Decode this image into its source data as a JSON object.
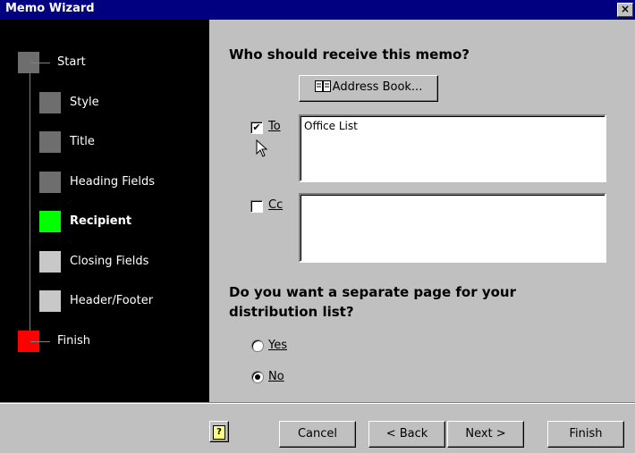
{
  "window": {
    "title": "Memo Wizard",
    "close_glyph": "×"
  },
  "steps": [
    {
      "label": "Start",
      "color": "#6e6e6e"
    },
    {
      "label": "Style",
      "color": "#6e6e6e"
    },
    {
      "label": "Title",
      "color": "#6e6e6e"
    },
    {
      "label": "Heading Fields",
      "color": "#6e6e6e"
    },
    {
      "label": "Recipient",
      "color": "#00ff00",
      "current": true
    },
    {
      "label": "Closing Fields",
      "color": "#c8c8c8"
    },
    {
      "label": "Header/Footer",
      "color": "#c8c8c8"
    },
    {
      "label": "Finish",
      "color": "#ff0000"
    }
  ],
  "main": {
    "question1": "Who should receive this memo?",
    "address_book": {
      "label": "Address Book...",
      "icon": "address-book-icon"
    },
    "to": {
      "label": "To",
      "checked": true,
      "value": "Office List"
    },
    "cc": {
      "label": "Cc",
      "checked": false,
      "value": ""
    },
    "question2_line1": "Do you want a separate page for your",
    "question2_line2": "distribution list?",
    "yes": {
      "label": "Yes",
      "selected": false
    },
    "no": {
      "label": "No",
      "selected": true
    }
  },
  "footer": {
    "help_icon": "help-icon",
    "cancel": "Cancel",
    "back": "< Back",
    "next": "Next >",
    "finish": "Finish"
  }
}
